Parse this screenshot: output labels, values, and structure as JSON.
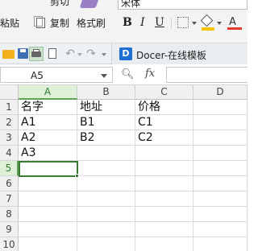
{
  "ribbon": {
    "cut_label_partial": "剪切",
    "paste_label": "粘贴",
    "copy_label": "复制",
    "format_painter_label": "格式刷",
    "font_name": "宋体",
    "bold": "B",
    "italic": "I",
    "underline": "U"
  },
  "toolbar": {
    "docer_icon_letter": "D",
    "docer_tab_label": "Docer-在线模板"
  },
  "formula_bar": {
    "name_box": "A5",
    "fx_label": "fx",
    "formula": ""
  },
  "grid": {
    "columns": [
      "A",
      "B",
      "C",
      "D"
    ],
    "selected_column": "A",
    "rows": [
      "1",
      "2",
      "3",
      "4",
      "5",
      "6",
      "7",
      "8",
      "9",
      "10"
    ],
    "selected_row": "5",
    "cells": [
      [
        "名字",
        "地址",
        "价格",
        ""
      ],
      [
        "A1",
        "B1",
        "C1",
        ""
      ],
      [
        "A2",
        "B2",
        "C2",
        ""
      ],
      [
        "A3",
        "",
        "",
        ""
      ],
      [
        "",
        "",
        "",
        ""
      ]
    ],
    "active_cell": "A5"
  },
  "colors": {
    "selection_green": "#3b7a32",
    "header_highlight": "#dff0d8",
    "docer_blue": "#1e6fd1"
  }
}
